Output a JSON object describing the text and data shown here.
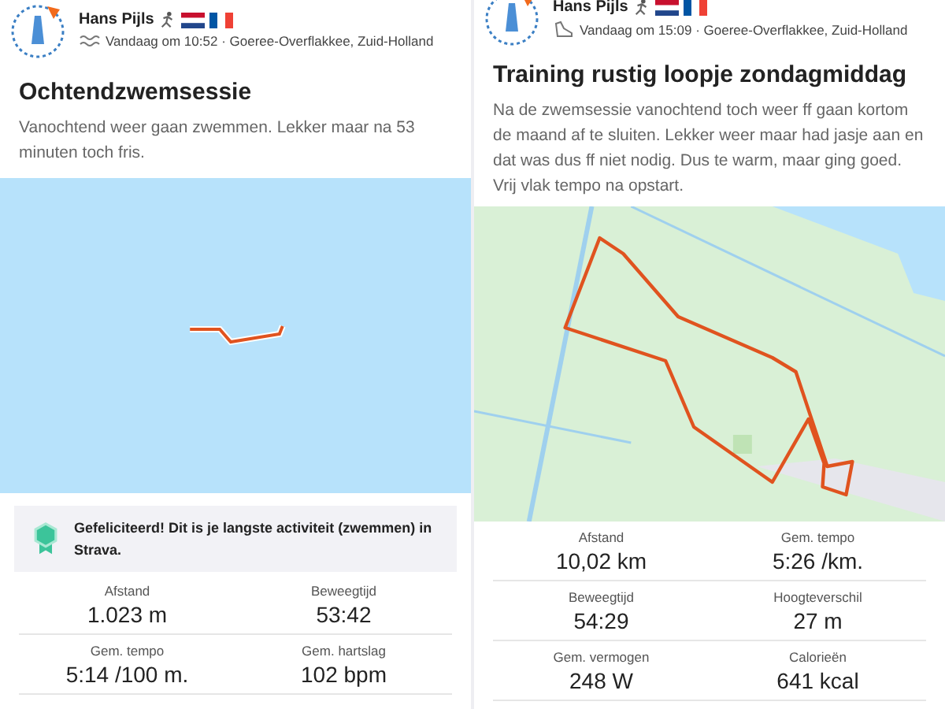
{
  "activities": [
    {
      "athlete": "Hans Pijls",
      "kind": "swim",
      "meta": "Vandaag om 10:52 · Goeree-Overflakkee, Zuid-Holland",
      "title": "Ochtendzwemsessie",
      "description": "Vanochtend weer gaan zwemmen. Lekker maar na 53 minuten toch fris.",
      "achievement": "Gefeliciteerd! Dit is je langste activiteit (zwemmen) in Strava.",
      "stats": [
        {
          "label": "Afstand",
          "value": "1.023 m"
        },
        {
          "label": "Beweegtijd",
          "value": "53:42"
        },
        {
          "label": "Gem. tempo",
          "value": "5:14 /100 m."
        },
        {
          "label": "Gem. hartslag",
          "value": "102 bpm"
        }
      ]
    },
    {
      "athlete": "Hans Pijls",
      "kind": "run",
      "meta": "Vandaag om 15:09 · Goeree-Overflakkee, Zuid-Holland",
      "title": "Training rustig loopje zondagmiddag",
      "description": "Na de zwemsessie vanochtend toch weer ff gaan kortom de maand af te sluiten. Lekker weer maar had jasje aan en dat was dus ff niet nodig. Dus te warm, maar ging goed. Vrij vlak tempo na opstart.",
      "stats": [
        {
          "label": "Afstand",
          "value": "10,02 km"
        },
        {
          "label": "Gem. tempo",
          "value": "5:26 /km."
        },
        {
          "label": "Beweegtijd",
          "value": "54:29"
        },
        {
          "label": "Hoogteverschil",
          "value": "27 m"
        },
        {
          "label": "Gem. vermogen",
          "value": "248 W"
        },
        {
          "label": "Calorieën",
          "value": "641 kcal"
        }
      ]
    }
  ]
}
